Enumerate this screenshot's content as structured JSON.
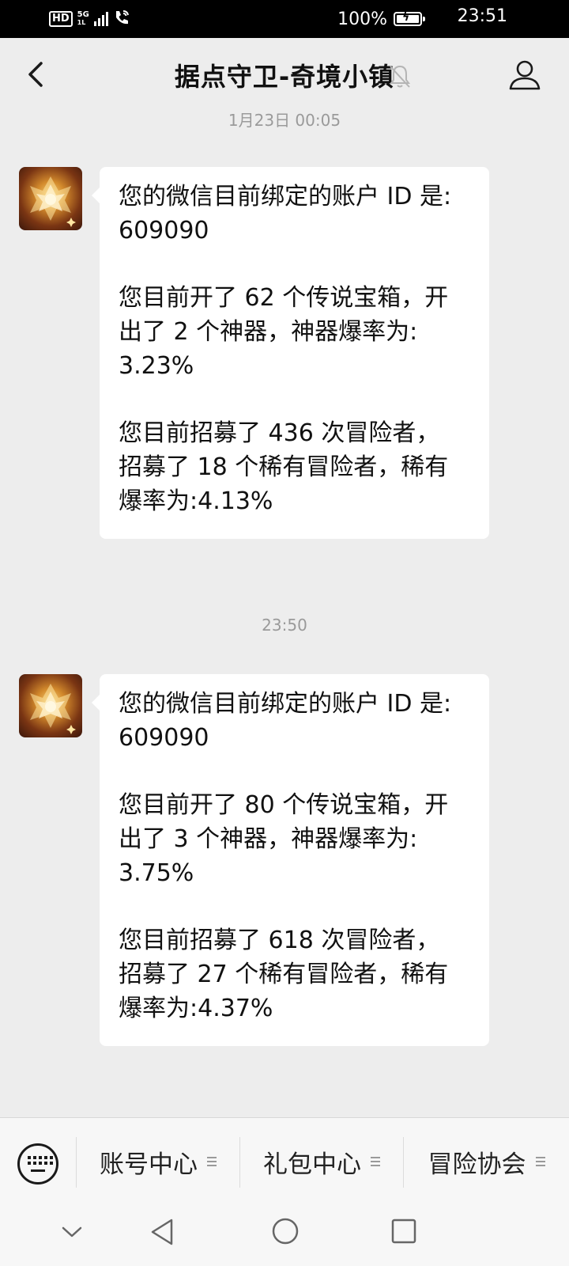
{
  "status_bar": {
    "hd": "HD",
    "network": "5G",
    "network_sub": "1L",
    "battery_percent": "100%",
    "battery_level": 1.0,
    "time": "23:51"
  },
  "header": {
    "title": "据点守卫-奇境小镇",
    "icons": [
      "back-icon",
      "mute-icon",
      "profile-icon"
    ]
  },
  "messages": [
    {
      "timestamp": "1月23日 00:05",
      "lines": [
        "您的微信目前绑定的账户 ID 是:\n609090",
        "您目前开了 62 个传说宝箱，开\n出了 2 个神器，神器爆率为:\n3.23%",
        "您目前招募了 436 次冒险者，\n招募了 18 个稀有冒险者，稀有\n爆率为:4.13%"
      ]
    },
    {
      "timestamp": "23:50",
      "lines": [
        "您的微信目前绑定的账户 ID 是:\n609090",
        "您目前开了 80 个传说宝箱，开\n出了 3 个神器，神器爆率为:\n3.75%",
        "您目前招募了 618 次冒险者，\n招募了 27 个稀有冒险者，稀有\n爆率为:4.37%"
      ]
    }
  ],
  "bottom_menu": {
    "items": [
      {
        "label": "账号中心"
      },
      {
        "label": "礼包中心"
      },
      {
        "label": "冒险协会"
      }
    ]
  },
  "colors": {
    "background": "#ededed",
    "bubble": "#ffffff",
    "timestamp_text": "#9a9a9a",
    "status_bar": "#000000"
  }
}
